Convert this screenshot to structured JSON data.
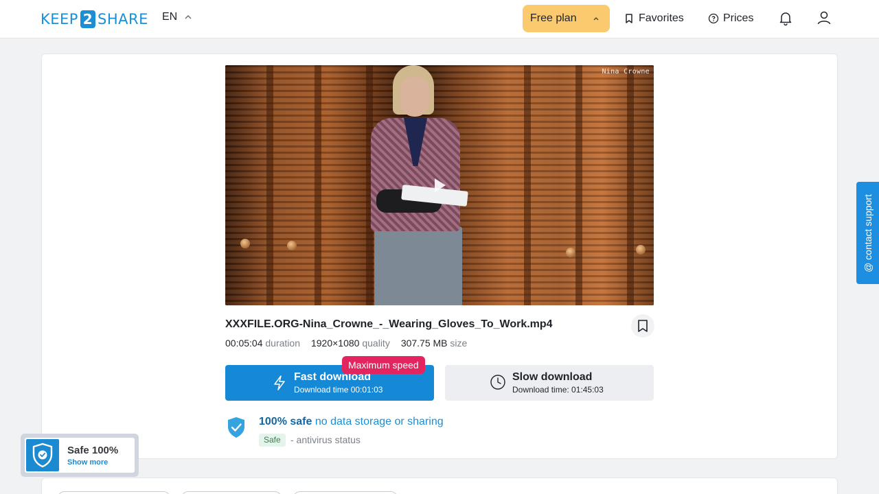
{
  "header": {
    "logo_left": "KEEP",
    "logo_num": "2",
    "logo_right": "SHARE",
    "language": "EN",
    "free_plan_label": "Free plan",
    "favorites_label": "Favorites",
    "prices_label": "Prices",
    "icons": [
      "chevron-up-icon",
      "bookmark-icon",
      "question-circle-icon",
      "bell-icon",
      "user-icon"
    ]
  },
  "video": {
    "watermark": "Nina Crowne"
  },
  "file": {
    "name": "XXXFILE.ORG-Nina_Crowne_-_Wearing_Gloves_To_Work.mp4",
    "duration_value": "00:05:04",
    "duration_label": "duration",
    "quality_value": "1920×1080",
    "quality_label": "quality",
    "size_value": "307.75 MB",
    "size_label": "size"
  },
  "download": {
    "fast_title": "Fast download",
    "fast_sub": "Download time 00:01:03",
    "max_speed_badge": "Maximum speed",
    "slow_title": "Slow download",
    "slow_sub": "Download time: 01:45:03"
  },
  "safety": {
    "headline_bold": "100% safe",
    "headline_rest": " no data storage or sharing",
    "tag": "Safe",
    "antivirus": "- antivirus status"
  },
  "widget": {
    "title": "Safe 100%",
    "link": "Show more"
  },
  "support": {
    "label": "@ contact support"
  },
  "colors": {
    "brand": "#1a8fd6",
    "free_plan_bg": "#fbc96e",
    "fast_button": "#1589d6",
    "badge": "#e4245f",
    "support_tab": "#1d8ee0"
  }
}
